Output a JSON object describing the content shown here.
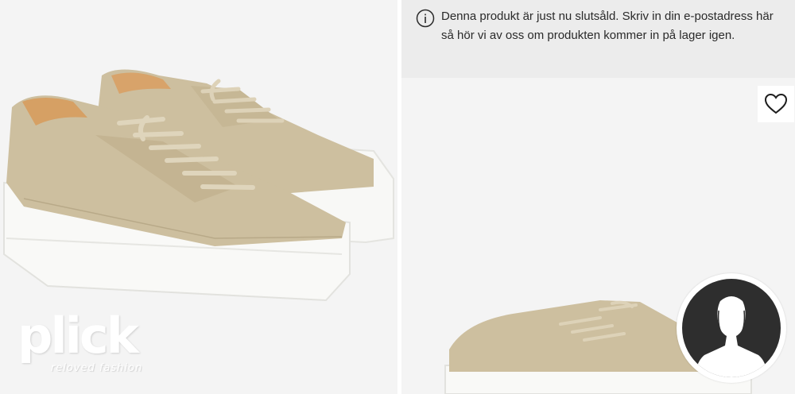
{
  "watermark": {
    "word": "plick",
    "tagline": "reloved fashion"
  },
  "notice": {
    "icon": "info-icon",
    "text": "Denna produkt är just nu slutsåld. Skriv in din e-postadress här så hör vi av oss om produkten kommer in på lager igen."
  },
  "favorite": {
    "icon": "heart-icon"
  },
  "avatar": {
    "icon": "user-silhouette-icon"
  },
  "colors": {
    "shoe": "#cdbf9f",
    "sole": "#f7f7f5",
    "notice_bg": "#ececec",
    "avatar_bg": "#2e2e2e"
  }
}
